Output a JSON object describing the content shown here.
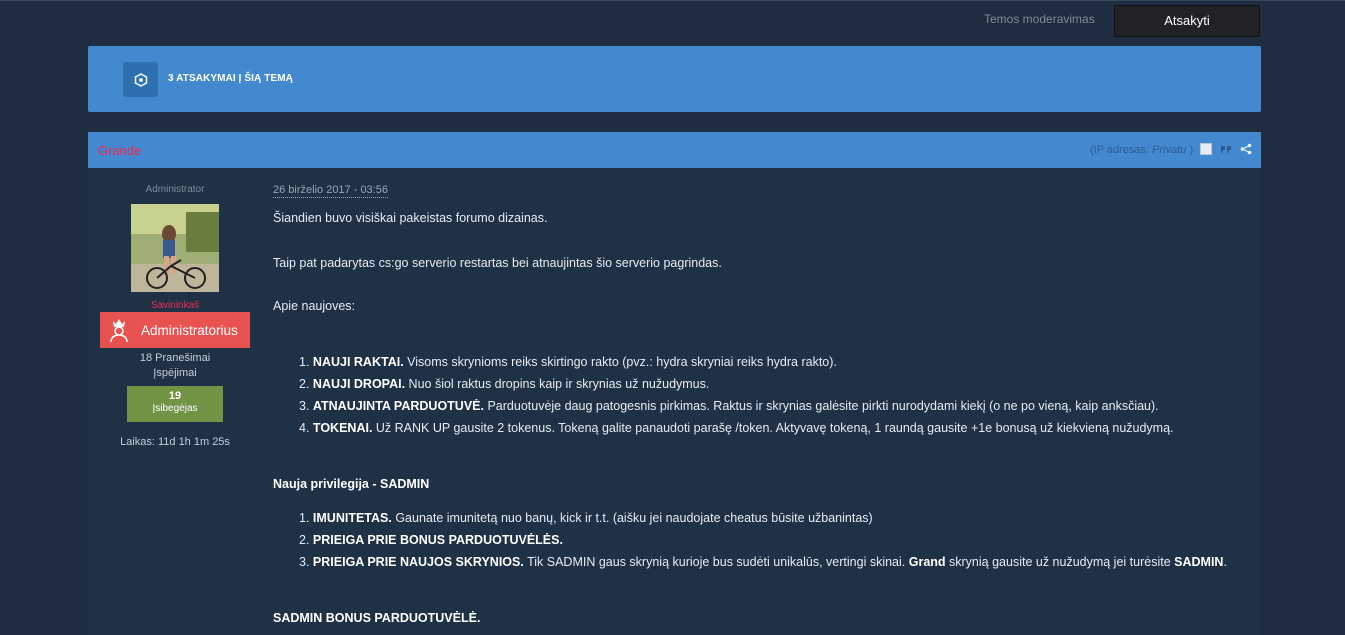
{
  "topbar": {
    "moderation_label": "Temos moderavimas",
    "reply_label": "Atsakyti"
  },
  "replies_bar": {
    "title": "3 ATSAKYMAI Į ŠIĄ TEMĄ",
    "icon": "hexagon-icon"
  },
  "post": {
    "author": "Grande",
    "ip_label": "(IP adresas:",
    "ip_value": "Privatu",
    "ip_close": ")",
    "sidebar": {
      "group_title": "Administrator",
      "nick": "Savininkaš",
      "rank_label": "Administratorius",
      "posts": "18 Pranešimai",
      "warnings": "Įspėjimai",
      "reputation_value": "19",
      "reputation_label": "Įsibegėjas",
      "time": "Laikas: 11d 1h 1m 25s"
    },
    "date": "26 birželio 2017 - 03:56",
    "paragraphs": {
      "p1": "Šiandien buvo visiškai pakeistas forumo dizainas.",
      "p2": "Taip pat padarytas cs:go serverio restartas bei atnaujintas šio serverio pagrindas.",
      "p3": "Apie naujoves:"
    },
    "list1": [
      {
        "num": "1.",
        "bold": "NAUJI RAKTAI.",
        "text": " Visoms skrynioms reiks skirtingo rakto (pvz.: hydra skryniai reiks hydra rakto)."
      },
      {
        "num": "2.",
        "bold": "NAUJI DROPAI.",
        "text": " Nuo šiol raktus dropins kaip ir skrynias už nužudymus."
      },
      {
        "num": "3.",
        "bold": "ATNAUJINTA PARDUOTUVĖ.",
        "text": " Parduotuvėje daug patogesnis pirkimas. Raktus ir skrynias galėsite pirkti nurodydami kiekį (o ne po vieną, kaip anksčiau)."
      },
      {
        "num": "4.",
        "bold": "TOKENAI.",
        "text": " Už RANK UP gausite 2 tokenus. Tokeną galite panaudoti parašę /token. Aktyvavę tokeną, 1 raundą gausite +1e bonusą už kiekvieną nužudymą."
      }
    ],
    "heading2": "Nauja privilegija - SADMIN",
    "list2": [
      {
        "num": "1.",
        "bold": "IMUNITETAS.",
        "text": " Gaunate imunitetą nuo banų, kick ir t.t. (aišku jei naudojate cheatus būsite užbanintas)"
      },
      {
        "num": "2.",
        "bold": "PRIEIGA PRIE BONUS PARDUOTUVĖLĖS.",
        "text": ""
      },
      {
        "num": "3.",
        "bold": "PRIEIGA PRIE NAUJOS SKRYNIOS.",
        "text": " Tik SADMIN gaus skrynią kurioje bus sudėti unikalūs, vertingi skinai. ",
        "bold2": "Grand",
        "text2": " skrynią gausite už nužudymą jei turėsite ",
        "bold3": "SADMIN",
        "text3": "."
      }
    ],
    "heading3": "SADMIN BONUS PARDUOTUVĖLĖ."
  },
  "colors": {
    "background": "#1e2e40",
    "accent_blue": "#4389d0",
    "author_red": "#f02a4e",
    "rank_badge": "#e85352",
    "reputation_green": "#709344"
  }
}
